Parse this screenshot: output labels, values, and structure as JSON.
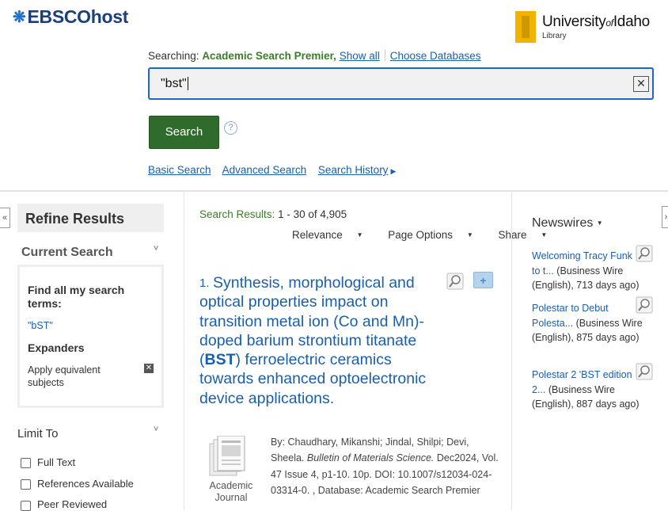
{
  "header": {
    "logo_text": "EBSCOhost",
    "institution_name": "University",
    "institution_of": "of",
    "institution_place": "Idaho",
    "institution_sub": "Library",
    "brand_color": "#1b3f7a",
    "accent_color": "#f1b300"
  },
  "search": {
    "searching_label": "Searching:",
    "database": "Academic Search Premier,",
    "show_all": "Show all",
    "choose_db": "Choose Databases",
    "query": "\"bst\"",
    "clear_icon": "close-icon",
    "button_label": "Search",
    "help_label": "?",
    "links": {
      "basic": "Basic Search",
      "advanced": "Advanced Search",
      "history": "Search History"
    }
  },
  "sidebar": {
    "collapse_label": "«",
    "refine_title": "Refine Results",
    "current_search": "Current Search",
    "find_all": "Find all my search terms:",
    "term": "\"bST\"",
    "expanders": "Expanders",
    "apply_equivalent": "Apply equivalent subjects",
    "remove_label": "✕",
    "limit_to": "Limit To",
    "limits": [
      {
        "label": "Full Text",
        "checked": false
      },
      {
        "label": "References Available",
        "checked": false
      },
      {
        "label": "Peer Reviewed",
        "checked": false
      }
    ]
  },
  "results": {
    "count_label": "Search Results:",
    "count_value": "1 - 30 of 4,905",
    "sort": "Relevance",
    "page_options": "Page Options",
    "share": "Share",
    "items": [
      {
        "num": "1.",
        "title_pre": "Synthesis, morphological and optical properties impact on transition metal ion (Co and Mn)-doped barium strontium titanate (",
        "title_bold": "BST",
        "title_post": ") ferroelectric ceramics towards enhanced optoelectronic device applications.",
        "type": "Academic Journal",
        "authors": "By: Chaudhary, Mikanshi; Jindal, Shilpi; Devi, Sheela.",
        "journal": "Bulletin of Materials Science.",
        "details": "Dec2024, Vol. 47 Issue 4, p1-10. 10p. DOI: 10.1007/s12034-024-03314-0. , Database: Academic Search Premier"
      }
    ]
  },
  "newswires": {
    "title": "Newswires",
    "items": [
      {
        "link": "Welcoming Tracy Funk to t...",
        "meta": "(Business Wire (English), 713 days ago)"
      },
      {
        "link": "Polestar to Debut Polesta...",
        "meta": "(Business Wire (English), 875 days ago)"
      },
      {
        "link": "Polestar 2 'BST edition 2...",
        "meta": "(Business Wire (English), 887 days ago)"
      }
    ]
  },
  "right_collapse_label": "›"
}
